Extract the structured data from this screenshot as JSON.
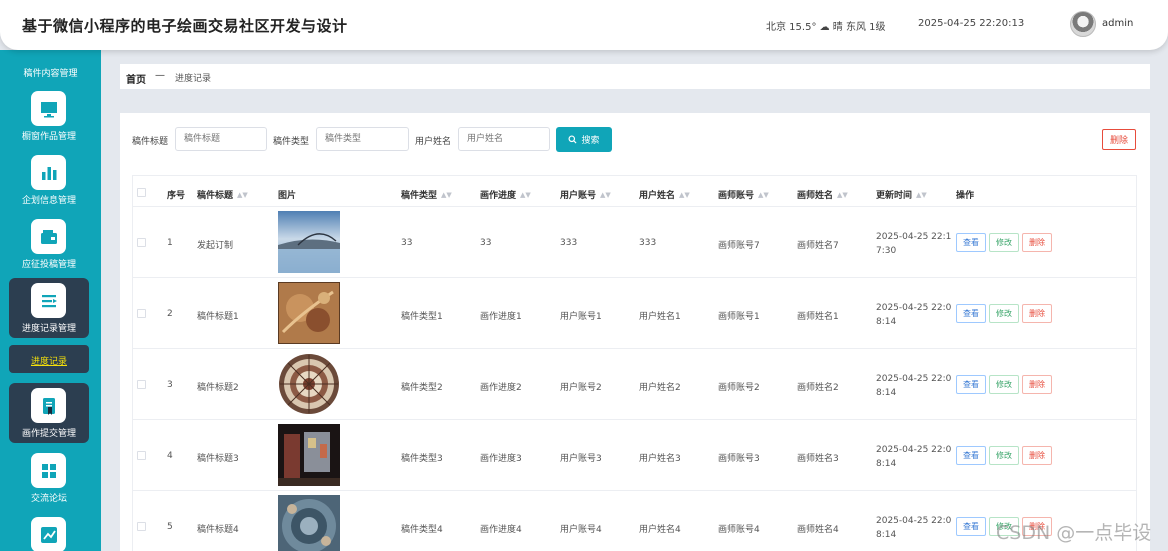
{
  "header": {
    "title": "基于微信小程序的电子绘画交易社区开发与设计",
    "weather": "北京 15.5° ☁ 晴 东风 1级",
    "datetime": "2025-04-25 22:20:13",
    "username": "admin"
  },
  "sidebar": {
    "cut_item_label": "稿件内容管理",
    "items": [
      {
        "label": "橱窗作品管理",
        "icon": "monitor-icon"
      },
      {
        "label": "企划信息管理",
        "icon": "bar-chart-icon"
      },
      {
        "label": "应征投稿管理",
        "icon": "wallet-icon"
      },
      {
        "label": "进度记录管理",
        "icon": "list-icon"
      },
      {
        "label": "画作提交管理",
        "icon": "document-icon"
      },
      {
        "label": "交流论坛",
        "icon": "grid-icon"
      },
      {
        "label": "",
        "icon": "trend-icon"
      }
    ],
    "active_sub": "进度记录"
  },
  "breadcrumb": {
    "home": "首页",
    "separator": "—",
    "current": "进度记录"
  },
  "filters": {
    "title_label": "稿件标题",
    "title_placeholder": "稿件标题",
    "type_label": "稿件类型",
    "type_placeholder": "稿件类型",
    "user_label": "用户姓名",
    "user_placeholder": "用户姓名",
    "search_label": "搜索",
    "delete_label": "删除"
  },
  "table": {
    "columns": [
      "序号",
      "稿件标题",
      "图片",
      "稿件类型",
      "画作进度",
      "用户账号",
      "用户姓名",
      "画师账号",
      "画师姓名",
      "更新时间",
      "操作"
    ],
    "actions": {
      "view": "查看",
      "edit": "修改",
      "delete": "删除"
    },
    "rows": [
      {
        "no": "1",
        "title": "发起订制",
        "type": "33",
        "progress": "33",
        "account": "333",
        "name": "333",
        "artist_account": "画师账号7",
        "artist_name": "画师姓名7",
        "time": "2025-04-25 22:17:30",
        "image": "bridge-lake"
      },
      {
        "no": "2",
        "title": "稿件标题1",
        "type": "稿件类型1",
        "progress": "画作进度1",
        "account": "用户账号1",
        "name": "用户姓名1",
        "artist_account": "画师账号1",
        "artist_name": "画师姓名1",
        "time": "2025-04-25 22:08:14",
        "image": "ornate-painting"
      },
      {
        "no": "3",
        "title": "稿件标题2",
        "type": "稿件类型2",
        "progress": "画作进度2",
        "account": "用户账号2",
        "name": "用户姓名2",
        "artist_account": "画师账号2",
        "artist_name": "画师姓名2",
        "time": "2025-04-25 22:08:14",
        "image": "mandala-plate"
      },
      {
        "no": "4",
        "title": "稿件标题3",
        "type": "稿件类型3",
        "progress": "画作进度3",
        "account": "用户账号3",
        "name": "用户姓名3",
        "artist_account": "画师账号3",
        "artist_name": "画师姓名3",
        "time": "2025-04-25 22:08:14",
        "image": "night-room"
      },
      {
        "no": "5",
        "title": "稿件标题4",
        "type": "稿件类型4",
        "progress": "画作进度4",
        "account": "用户账号4",
        "name": "用户姓名4",
        "artist_account": "画师账号4",
        "artist_name": "画师姓名4",
        "time": "2025-04-25 22:08:14",
        "image": "blue-ceramic"
      }
    ]
  },
  "watermark": "CSDN @一点毕设",
  "colors": {
    "accent": "#10a5b8",
    "sidebar_active": "#2c3e50",
    "danger": "#e74c3c"
  }
}
